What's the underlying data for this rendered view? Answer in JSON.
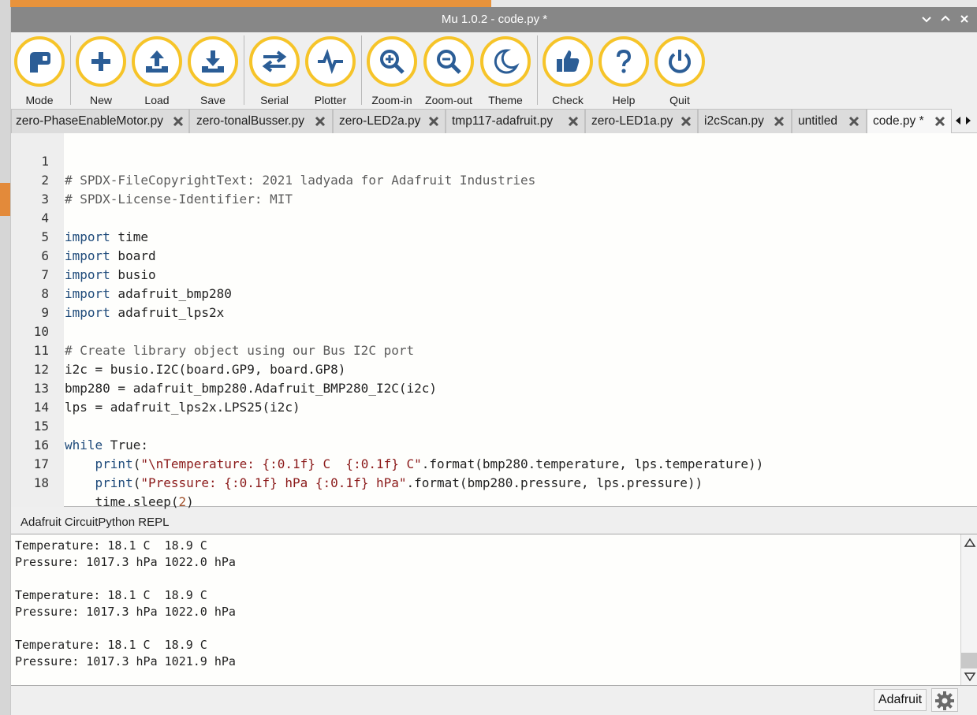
{
  "window": {
    "title": "Mu 1.0.2 - code.py *"
  },
  "toolbar": {
    "buttons": [
      {
        "label": "Mode",
        "icon": "mode-icon"
      },
      {
        "label": "New",
        "icon": "plus-icon"
      },
      {
        "label": "Load",
        "icon": "upload-icon"
      },
      {
        "label": "Save",
        "icon": "download-icon"
      },
      {
        "label": "Serial",
        "icon": "swap-arrows-icon"
      },
      {
        "label": "Plotter",
        "icon": "pulse-icon"
      },
      {
        "label": "Zoom-in",
        "icon": "zoom-in-icon"
      },
      {
        "label": "Zoom-out",
        "icon": "zoom-out-icon"
      },
      {
        "label": "Theme",
        "icon": "moon-icon"
      },
      {
        "label": "Check",
        "icon": "thumbs-up-icon"
      },
      {
        "label": "Help",
        "icon": "question-icon"
      },
      {
        "label": "Quit",
        "icon": "power-icon"
      }
    ]
  },
  "tabs": [
    {
      "label": "zero-PhaseEnableMotor.py"
    },
    {
      "label": "zero-tonalBusser.py"
    },
    {
      "label": "zero-LED2a.py"
    },
    {
      "label": "tmp117-adafruit.py"
    },
    {
      "label": "zero-LED1a.py"
    },
    {
      "label": "i2cScan.py"
    },
    {
      "label": "untitled"
    },
    {
      "label": "code.py *"
    }
  ],
  "editor": {
    "lines": [
      {
        "n": "1",
        "comment": "# SPDX-FileCopyrightText: 2021 ladyada for Adafruit Industries"
      },
      {
        "n": "2",
        "comment": "# SPDX-License-Identifier: MIT"
      },
      {
        "n": "3"
      },
      {
        "n": "4",
        "kw": "import",
        "rest": " time"
      },
      {
        "n": "5",
        "kw": "import",
        "rest": " board"
      },
      {
        "n": "6",
        "kw": "import",
        "rest": " busio"
      },
      {
        "n": "7",
        "kw": "import",
        "rest": " adafruit_bmp280"
      },
      {
        "n": "8",
        "kw": "import",
        "rest": " adafruit_lps2x"
      },
      {
        "n": "9"
      },
      {
        "n": "10",
        "comment": "# Create library object using our Bus I2C port"
      },
      {
        "n": "11",
        "text": "i2c = busio.I2C(board.GP9, board.GP8)"
      },
      {
        "n": "12",
        "text": "bmp280 = adafruit_bmp280.Adafruit_BMP280_I2C(i2c)"
      },
      {
        "n": "13",
        "text": "lps = adafruit_lps2x.LPS25(i2c)"
      },
      {
        "n": "14"
      },
      {
        "n": "15",
        "kw": "while",
        "rest": " True:"
      },
      {
        "n": "16",
        "indent": "    ",
        "kw": "print",
        "rest": "(",
        "str": "\"\\nTemperature: {:0.1f} C  {:0.1f} C\"",
        "tail": ".format(bmp280.temperature, lps.temperature))"
      },
      {
        "n": "17",
        "indent": "    ",
        "kw": "print",
        "rest": "(",
        "str": "\"Pressure: {:0.1f} hPa {:0.1f} hPa\"",
        "tail": ".format(bmp280.pressure, lps.pressure))"
      },
      {
        "n": "18",
        "indent": "    ",
        "text": "time.sleep(",
        "num": "2",
        "tail": ")"
      }
    ]
  },
  "repl": {
    "title": "Adafruit CircuitPython REPL",
    "output": "Temperature: 18.1 C  18.9 C\nPressure: 1017.3 hPa 1022.0 hPa\n\nTemperature: 18.1 C  18.9 C\nPressure: 1017.3 hPa 1022.0 hPa\n\nTemperature: 18.1 C  18.9 C\nPressure: 1017.3 hPa 1021.9 hPa"
  },
  "statusbar": {
    "mode": "Adafruit",
    "settings_icon": "gear-icon"
  },
  "colors": {
    "titlebar": "#878787",
    "button_ring": "#f6c429",
    "icon": "#2b5d96",
    "active_tab": "#f7f7f7"
  }
}
